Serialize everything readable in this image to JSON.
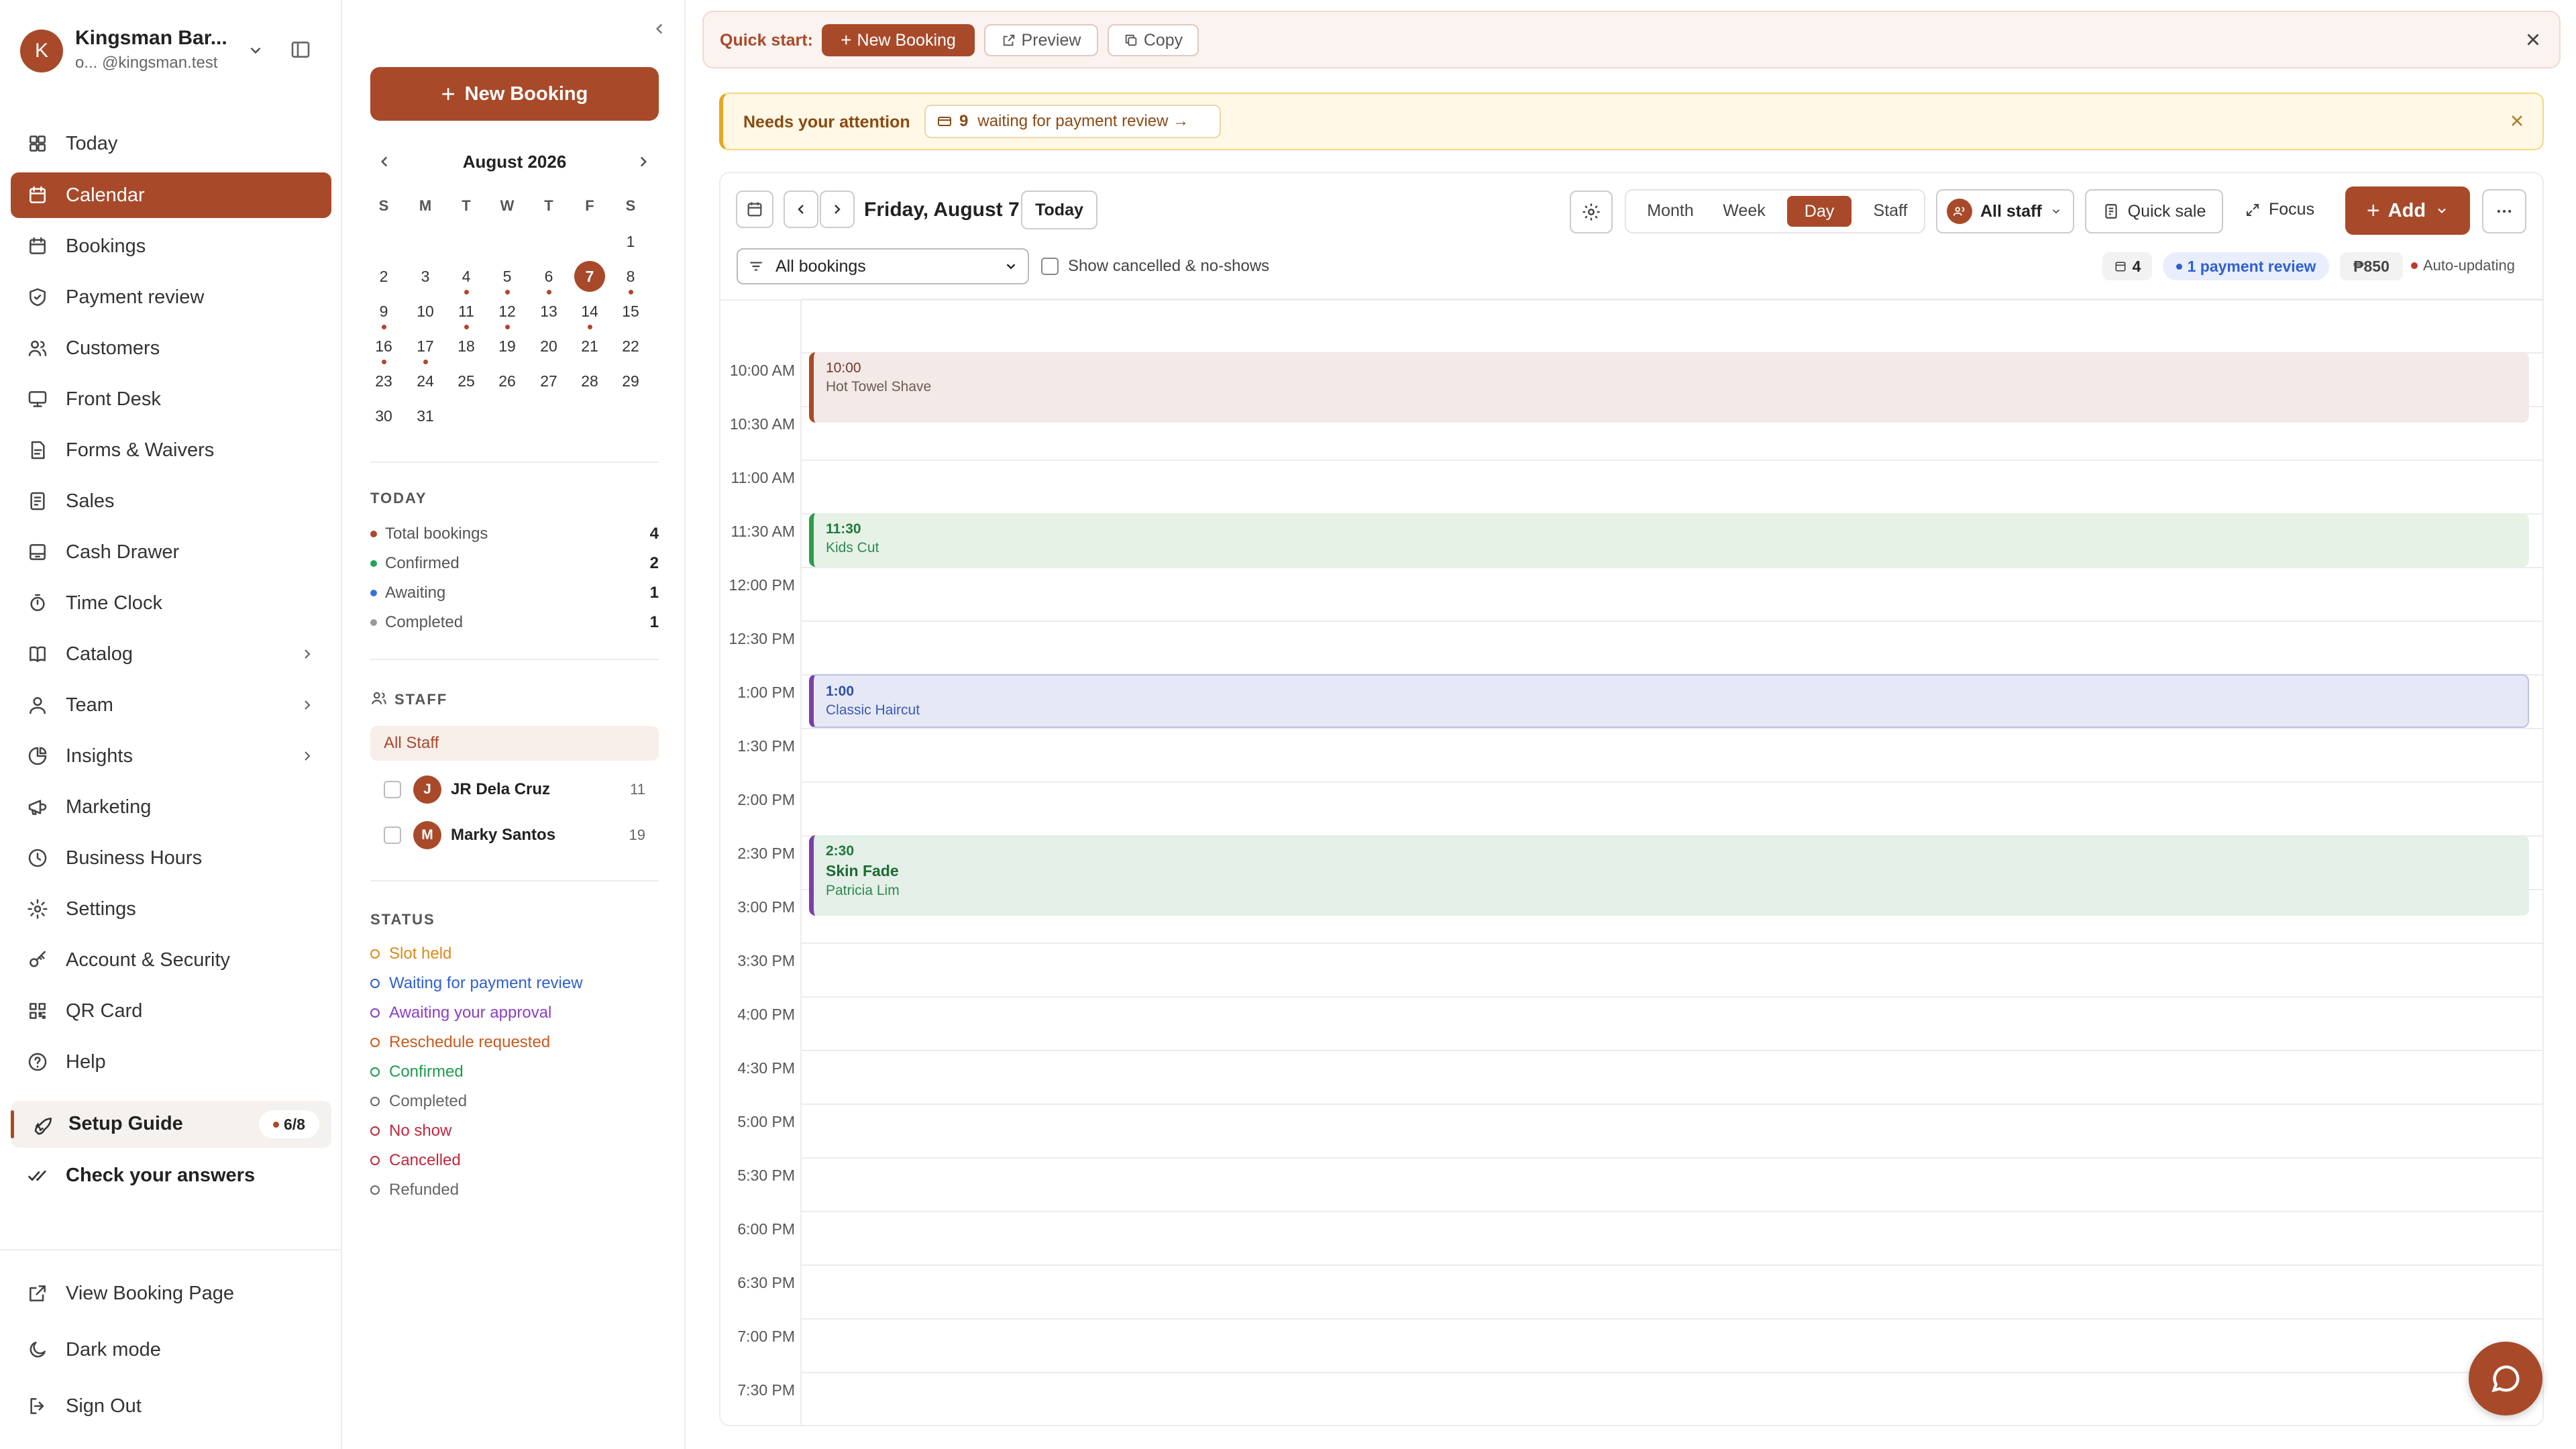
{
  "account": {
    "initial": "K",
    "name": "Kingsman Bar...",
    "handle_prefix": "o...",
    "handle": "@kingsman.test"
  },
  "nav": [
    {
      "label": "Today",
      "icon": "grid-icon"
    },
    {
      "label": "Calendar",
      "icon": "calendar-icon",
      "active": true
    },
    {
      "label": "Bookings",
      "icon": "calendar-icon"
    },
    {
      "label": "Payment review",
      "icon": "shield-icon"
    },
    {
      "label": "Customers",
      "icon": "users-icon"
    },
    {
      "label": "Front Desk",
      "icon": "monitor-icon"
    },
    {
      "label": "Forms & Waivers",
      "icon": "form-icon"
    },
    {
      "label": "Sales",
      "icon": "receipt-icon"
    },
    {
      "label": "Cash Drawer",
      "icon": "drawer-icon"
    },
    {
      "label": "Time Clock",
      "icon": "timer-icon"
    },
    {
      "label": "Catalog",
      "icon": "book-icon",
      "chevron": true
    },
    {
      "label": "Team",
      "icon": "team-icon",
      "chevron": true
    },
    {
      "label": "Insights",
      "icon": "pie-icon",
      "chevron": true
    },
    {
      "label": "Marketing",
      "icon": "megaphone-icon"
    },
    {
      "label": "Business Hours",
      "icon": "clock-icon"
    },
    {
      "label": "Settings",
      "icon": "gear-icon"
    },
    {
      "label": "Account & Security",
      "icon": "key-icon"
    },
    {
      "label": "QR Card",
      "icon": "qr-icon"
    },
    {
      "label": "Help",
      "icon": "help-icon"
    }
  ],
  "setup_guide": {
    "label": "Setup Guide",
    "progress": "6/8"
  },
  "check_answers": "Check your answers",
  "footer_nav": [
    {
      "label": "View Booking Page",
      "icon": "external-link-icon"
    },
    {
      "label": "Dark mode",
      "icon": "moon-icon"
    },
    {
      "label": "Sign Out",
      "icon": "sign-out-icon"
    }
  ],
  "panel": {
    "new_booking": "New Booking",
    "month_label": "August 2026",
    "weekdays": [
      "S",
      "M",
      "T",
      "W",
      "T",
      "F",
      "S"
    ],
    "days": [
      "1",
      "2",
      "3",
      "4",
      "5",
      "6",
      "7",
      "8",
      "9",
      "10",
      "11",
      "12",
      "13",
      "14",
      "15",
      "16",
      "17",
      "18",
      "19",
      "20",
      "21",
      "22",
      "23",
      "24",
      "25",
      "26",
      "27",
      "28",
      "29",
      "30",
      "31"
    ],
    "selected_day": "7",
    "today_title": "TODAY",
    "today_stats": [
      {
        "label": "Total bookings",
        "value": "4",
        "color": "#a84a2a"
      },
      {
        "label": "Confirmed",
        "value": "2",
        "color": "#22a35a"
      },
      {
        "label": "Awaiting",
        "value": "1",
        "color": "#3b6fe0"
      },
      {
        "label": "Completed",
        "value": "1",
        "color": "#999999"
      }
    ],
    "staff_title": "STAFF",
    "all_staff": "All Staff",
    "staff": [
      {
        "initial": "J",
        "name": "JR Dela Cruz",
        "count": "11"
      },
      {
        "initial": "M",
        "name": "Marky Santos",
        "count": "19"
      }
    ],
    "status_title": "STATUS",
    "statuses": [
      {
        "label": "Slot held",
        "color": "#d98a1a"
      },
      {
        "label": "Waiting for payment review",
        "color": "#2f5fd0"
      },
      {
        "label": "Awaiting your approval",
        "color": "#8a3fc4"
      },
      {
        "label": "Reschedule requested",
        "color": "#c85a1e"
      },
      {
        "label": "Confirmed",
        "color": "#1f9a4e"
      },
      {
        "label": "Completed",
        "color": "#666666"
      },
      {
        "label": "No show",
        "color": "#c0283c"
      },
      {
        "label": "Cancelled",
        "color": "#c0283c"
      },
      {
        "label": "Refunded",
        "color": "#666666"
      }
    ]
  },
  "quickstart": {
    "label": "Quick start:",
    "new_booking": "New Booking",
    "preview": "Preview",
    "copy": "Copy"
  },
  "attention": {
    "label": "Needs your attention",
    "count": "9",
    "text": "waiting for payment review →"
  },
  "toolbar": {
    "date": "Friday, August 7",
    "today": "Today",
    "views": [
      "Month",
      "Week",
      "Day",
      "Staff"
    ],
    "active_view": "Day",
    "all_staff": "All staff",
    "quick_sale": "Quick sale",
    "focus": "Focus",
    "add": "Add",
    "filter": "All bookings",
    "show_cancelled": "Show cancelled & no-shows",
    "count_badge": "4",
    "payment_badge": "1 payment review",
    "revenue_badge": "₱850",
    "auto_updating": "Auto-updating"
  },
  "times": [
    "10:00 AM",
    "10:30 AM",
    "11:00 AM",
    "11:30 AM",
    "12:00 PM",
    "12:30 PM",
    "1:00 PM",
    "1:30 PM",
    "2:00 PM",
    "2:30 PM",
    "3:00 PM",
    "3:30 PM",
    "4:00 PM",
    "4:30 PM",
    "5:00 PM",
    "5:30 PM",
    "6:00 PM",
    "6:30 PM",
    "7:00 PM",
    "7:30 PM"
  ],
  "events": [
    {
      "time": "10:00",
      "title": "Hot Towel Shave"
    },
    {
      "time": "11:30",
      "title": "Kids Cut"
    },
    {
      "time": "1:00",
      "title": "Classic Haircut"
    },
    {
      "time": "2:30",
      "title": "Skin Fade",
      "customer": "Patricia Lim"
    }
  ],
  "colors": {
    "brand": "#a84a2a"
  }
}
